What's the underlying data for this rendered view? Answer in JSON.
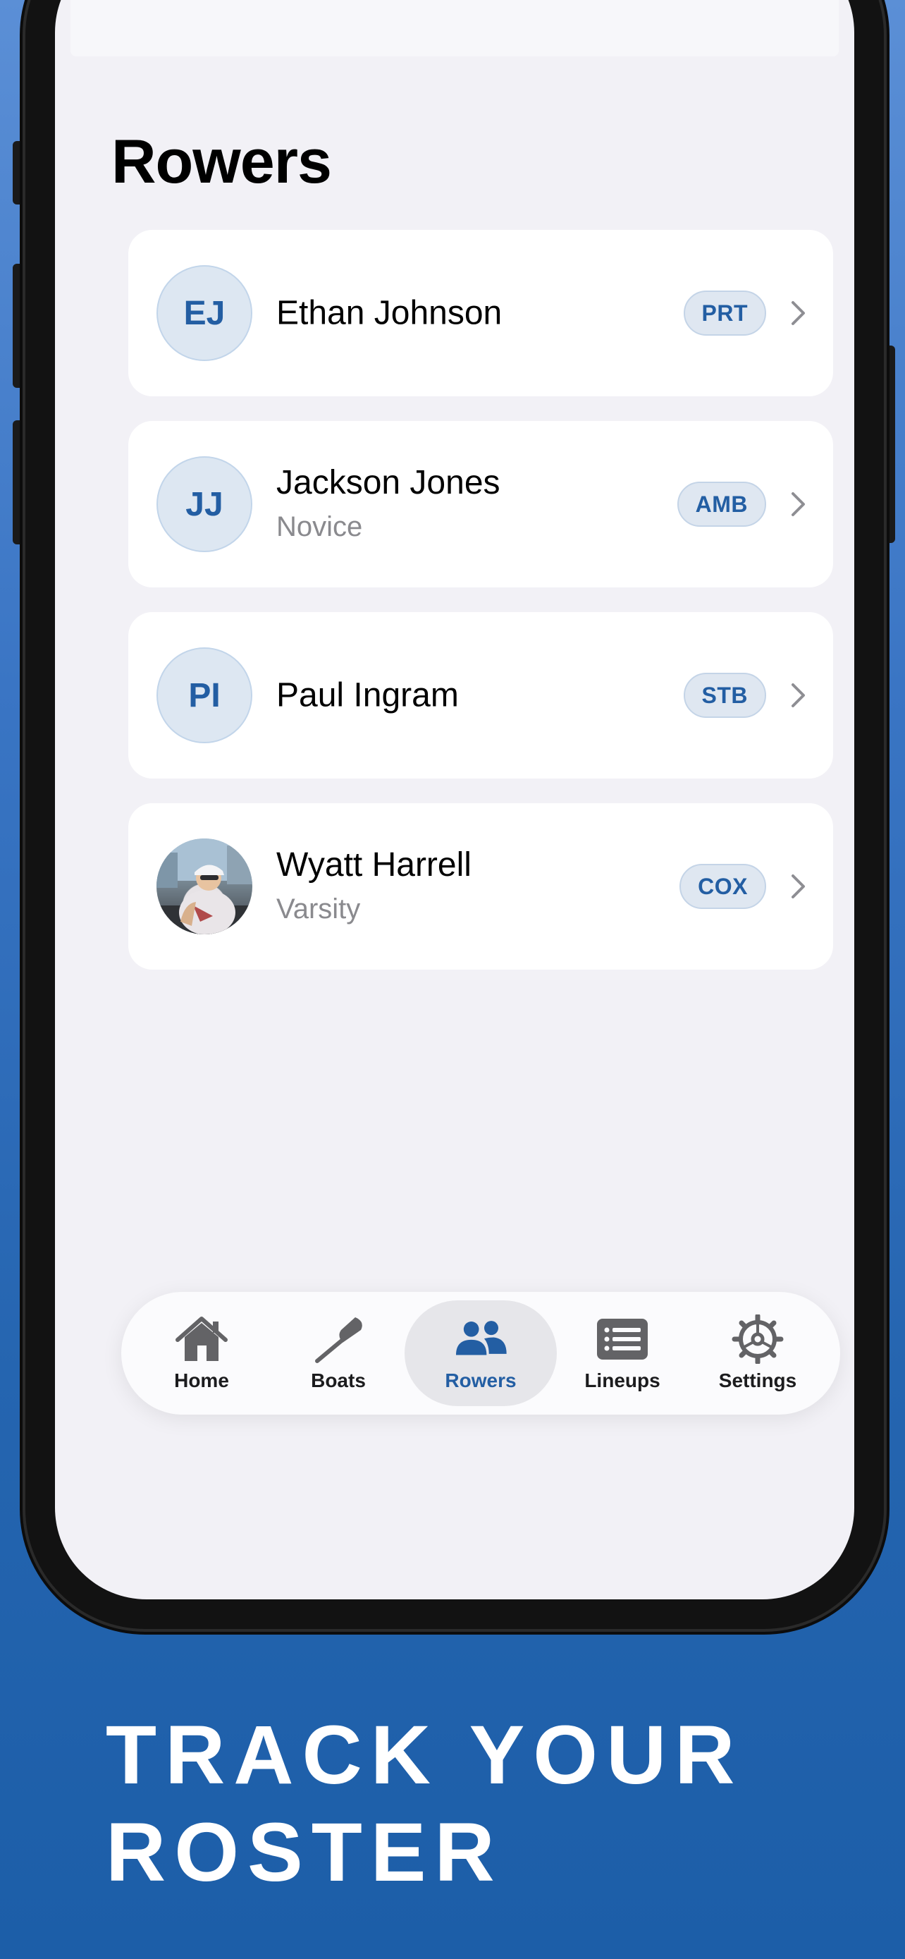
{
  "page": {
    "title": "Rowers"
  },
  "rowers": [
    {
      "initials": "EJ",
      "name": "Ethan Johnson",
      "subtitle": "",
      "badge": "PRT",
      "has_photo": false
    },
    {
      "initials": "JJ",
      "name": "Jackson Jones",
      "subtitle": "Novice",
      "badge": "AMB",
      "has_photo": false
    },
    {
      "initials": "PI",
      "name": "Paul Ingram",
      "subtitle": "",
      "badge": "STB",
      "has_photo": false
    },
    {
      "initials": "",
      "name": "Wyatt Harrell",
      "subtitle": "Varsity",
      "badge": "COX",
      "has_photo": true
    }
  ],
  "tabbar": {
    "items": [
      {
        "label": "Home",
        "icon": "house-icon",
        "active": false
      },
      {
        "label": "Boats",
        "icon": "oar-icon",
        "active": false
      },
      {
        "label": "Rowers",
        "icon": "people-icon",
        "active": true
      },
      {
        "label": "Lineups",
        "icon": "list-icon",
        "active": false
      },
      {
        "label": "Settings",
        "icon": "gear-icon",
        "active": false
      }
    ]
  },
  "tagline": {
    "line1": "TRACK YOUR",
    "line2": "ROSTER"
  },
  "colors": {
    "accent": "#235ea3",
    "badge_bg": "#dfe7f1",
    "screen_bg": "#f2f1f6",
    "card_bg": "#ffffff",
    "secondary_text": "#8a8a8e"
  }
}
